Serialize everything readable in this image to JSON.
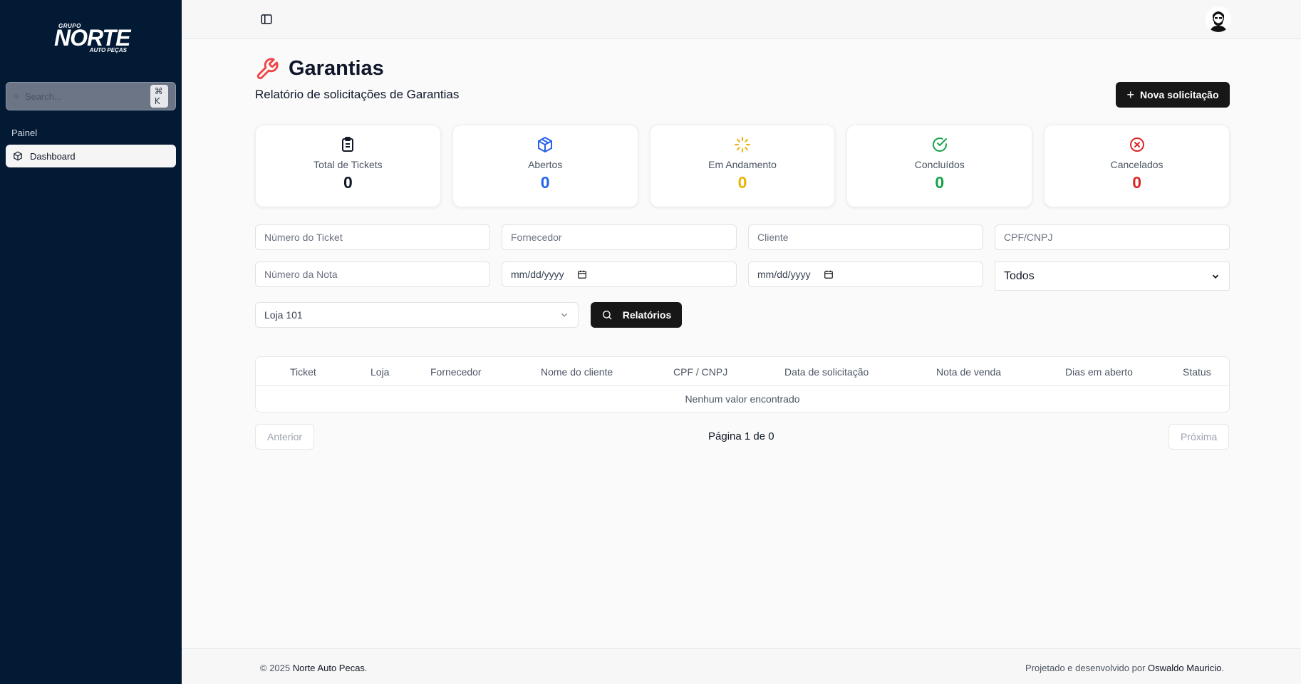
{
  "brand": {
    "grupo": "GRUPO",
    "name": "NORTE",
    "sub": "AUTO PEÇAS"
  },
  "sidebar": {
    "search_placeholder": "Search...",
    "shortcut": "⌘ K",
    "group_label": "Painel",
    "items": [
      {
        "label": "Dashboard",
        "icon": "box-icon",
        "active": true
      }
    ]
  },
  "page": {
    "title": "Garantias",
    "subtitle": "Relatório de solicitações de Garantias",
    "new_button": "Nova solicitação"
  },
  "stats": [
    {
      "label": "Total de Tickets",
      "value": "0",
      "color": "#111827",
      "icon": "clipboard-icon"
    },
    {
      "label": "Abertos",
      "value": "0",
      "color": "#2563eb",
      "icon": "package-icon"
    },
    {
      "label": "Em Andamento",
      "value": "0",
      "color": "#eab308",
      "icon": "loader-icon"
    },
    {
      "label": "Concluídos",
      "value": "0",
      "color": "#16a34a",
      "icon": "check-circle-icon"
    },
    {
      "label": "Cancelados",
      "value": "0",
      "color": "#dc2626",
      "icon": "x-circle-icon"
    }
  ],
  "filters": {
    "ticket_placeholder": "Número do Ticket",
    "fornecedor_placeholder": "Fornecedor",
    "cliente_placeholder": "Cliente",
    "cpf_placeholder": "CPF/CNPJ",
    "nota_placeholder": "Número da Nota",
    "date_from": "mm/dd/yyyy",
    "date_to": "mm/dd/yyyy",
    "status_selected": "Todos",
    "loja_selected": "Loja 101",
    "report_button": "Relatórios"
  },
  "table": {
    "columns": [
      "Ticket",
      "Loja",
      "Fornecedor",
      "Nome do cliente",
      "CPF / CNPJ",
      "Data de solicitação",
      "Nota de venda",
      "Dias em aberto",
      "Status"
    ],
    "empty_text": "Nenhum valor encontrado"
  },
  "pagination": {
    "prev": "Anterior",
    "next": "Próxima",
    "info": "Página 1 de 0"
  },
  "footer": {
    "copyright": "© 2025",
    "company": "Norte Auto Pecas",
    "credit": "Projetado e desenvolvido por",
    "author": "Oswaldo Mauricio"
  },
  "colors": {
    "sidebar_bg": "#031a35",
    "accent_red": "#ef4444",
    "primary_btn": "#171717"
  }
}
